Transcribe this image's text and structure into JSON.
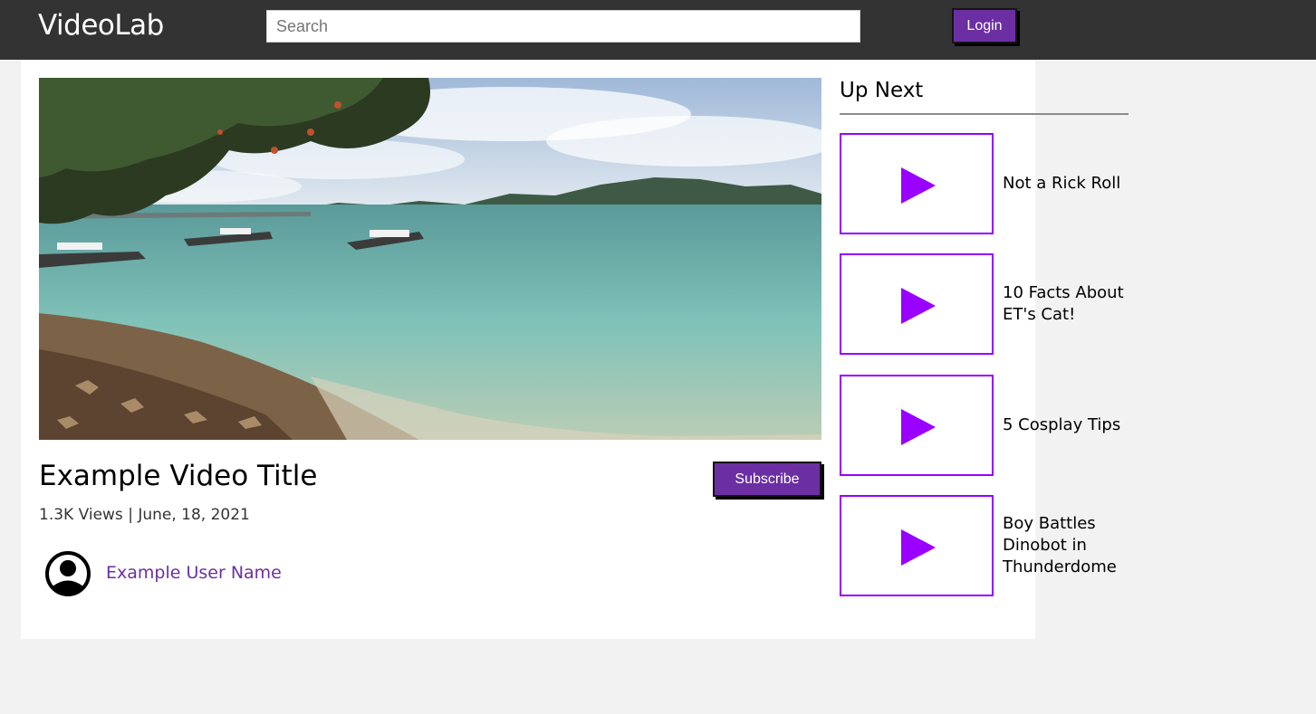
{
  "header": {
    "logo": "VideoLab",
    "search_placeholder": "Search",
    "login_label": "Login"
  },
  "video": {
    "title": "Example Video Title",
    "meta": "1.3K Views | June, 18, 2021",
    "subscribe_label": "Subscribe",
    "user_name": "Example User Name",
    "thumbnail_icon": "beach-scene-image",
    "avatar_icon": "user-avatar-icon"
  },
  "up_next": {
    "heading": "Up Next",
    "items": [
      {
        "title": "Not a Rick Roll",
        "icon": "play-icon"
      },
      {
        "title": "10 Facts About ET's Cat!",
        "icon": "play-icon"
      },
      {
        "title": "5 Cosplay Tips",
        "icon": "play-icon"
      },
      {
        "title": "Boy Battles Dinobot in Thunderdome",
        "icon": "play-icon"
      }
    ]
  },
  "colors": {
    "accent": "#6b2fa3",
    "play": "#9900ff",
    "topbar": "#333333",
    "page_bg": "#f2f2f2"
  }
}
